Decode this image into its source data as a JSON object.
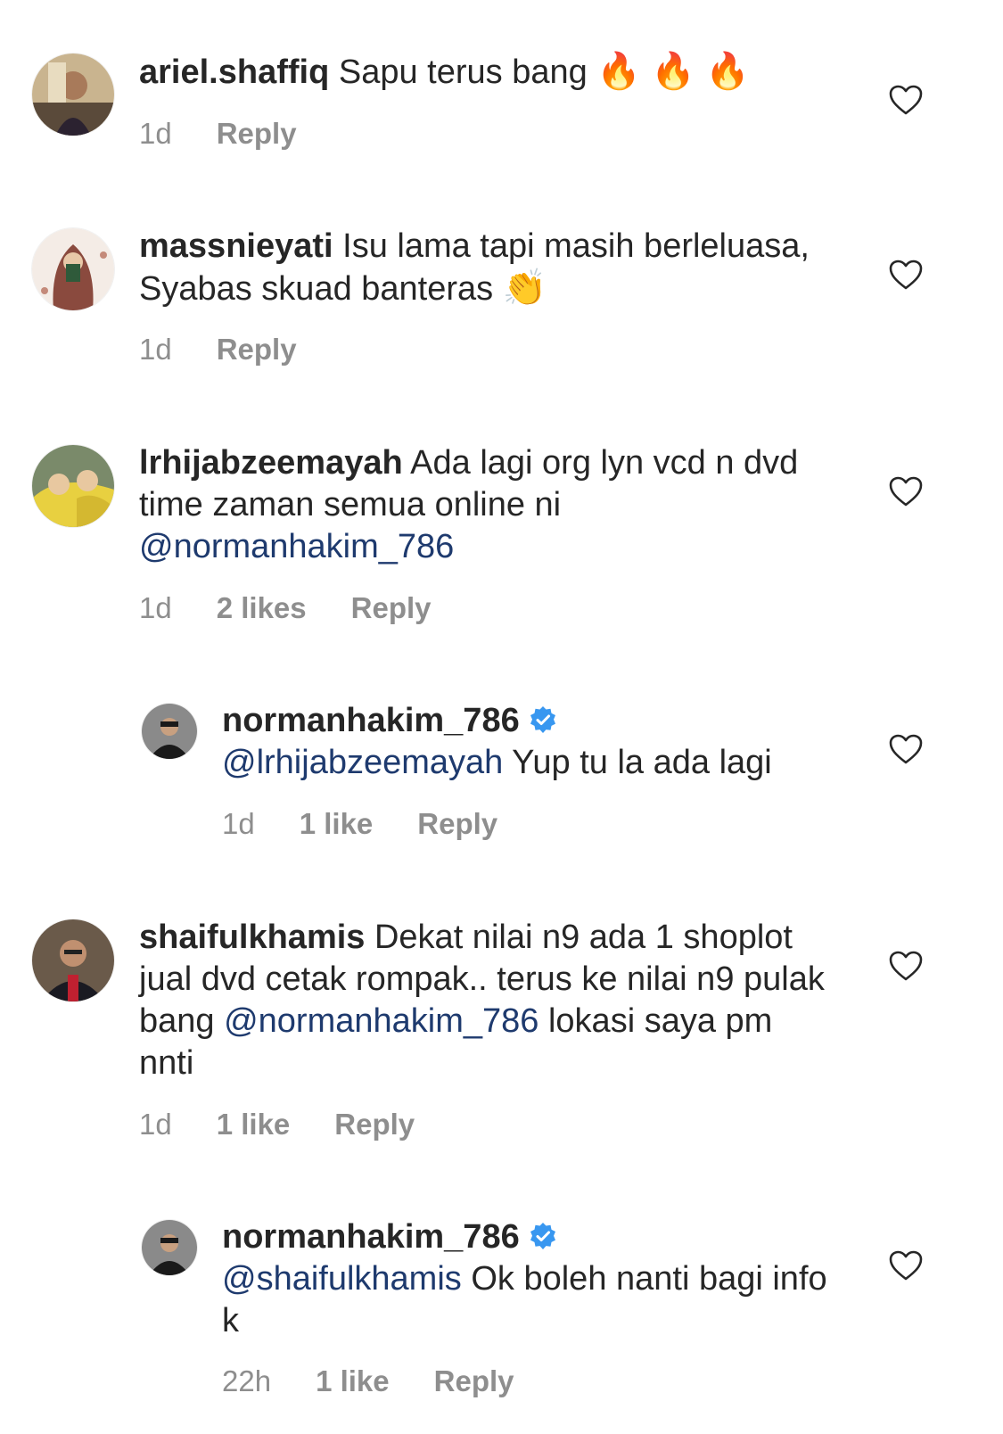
{
  "comments": [
    {
      "username": "ariel.shaffiq",
      "text": " Sapu terus bang ",
      "emoji": "🔥 🔥 🔥",
      "time": "1d",
      "reply": "Reply"
    },
    {
      "username": "massnieyati",
      "text": " Isu lama tapi masih berleluasa, Syabas skuad banteras ",
      "emoji": "👏",
      "time": "1d",
      "reply": "Reply"
    },
    {
      "username": "lrhijabzeemayah",
      "text": " Ada lagi org lyn vcd n dvd time zaman semua online ni ",
      "mention": "@normanhakim_786",
      "time": "1d",
      "likes": "2 likes",
      "reply": "Reply"
    },
    {
      "username": "normanhakim_786",
      "verified": true,
      "mention": "@lrhijabzeemayah",
      "text": " Yup tu la ada lagi",
      "time": "1d",
      "likes": "1 like",
      "reply": "Reply"
    },
    {
      "username": "shaifulkhamis",
      "text": " Dekat nilai n9 ada 1 shoplot jual dvd cetak rompak.. terus ke nilai n9 pulak bang ",
      "mention": "@normanhakim_786",
      "text2": " lokasi saya pm nnti",
      "time": "1d",
      "likes": "1 like",
      "reply": "Reply"
    },
    {
      "username": "normanhakim_786",
      "verified": true,
      "mention": "@shaifulkhamis",
      "text": " Ok boleh nanti bagi info k",
      "time": "22h",
      "likes": "1 like",
      "reply": "Reply"
    }
  ],
  "colors": {
    "text": "#262626",
    "meta": "#8e8e8e",
    "mention": "#1e3a6e",
    "verified": "#3897f0"
  },
  "icons": {
    "like": "heart-outline-icon",
    "verified": "verified-badge-icon"
  }
}
